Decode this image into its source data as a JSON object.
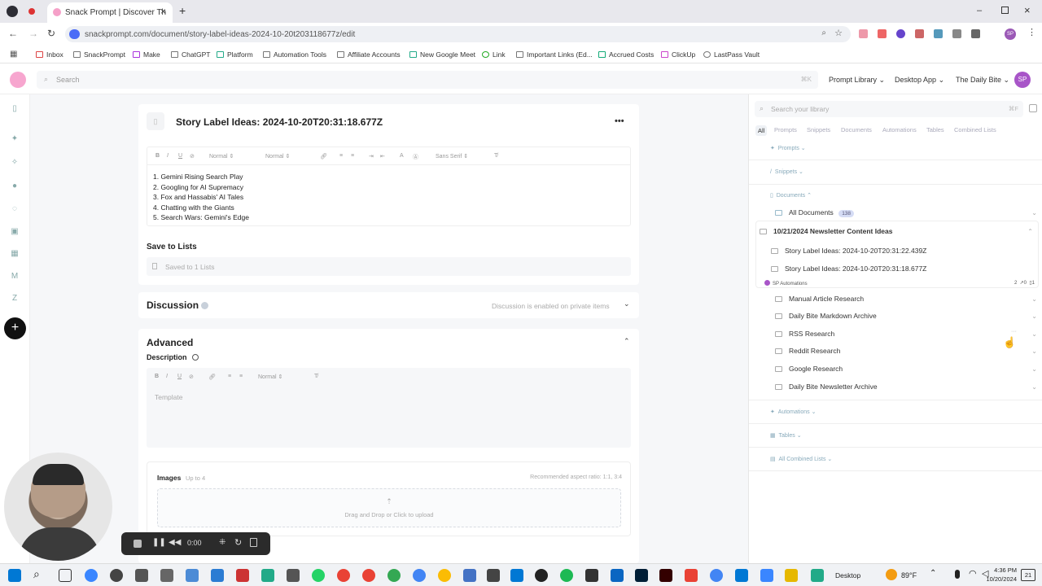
{
  "browser": {
    "tab_title": "Snack Prompt | Discover Th",
    "url": "snackprompt.com/document/story-label-ideas-2024-10-20t203118677z/edit",
    "bookmarks": [
      "Inbox",
      "SnackPrompt",
      "Make",
      "ChatGPT",
      "Platform",
      "Automation Tools",
      "Affiliate Accounts",
      "New Google Meet",
      "Link",
      "Important Links (Ed...",
      "Accrued Costs",
      "ClickUp",
      "LastPass Vault"
    ],
    "profile_initials": "SP"
  },
  "header": {
    "search_placeholder": "Search",
    "search_shortcut": "⌘K",
    "menus": [
      "Prompt Library",
      "Desktop App",
      "The Daily Bite"
    ],
    "avatar": "SP"
  },
  "document": {
    "title": "Story Label Ideas: 2024-10-20T20:31:18.677Z",
    "more_icon": "•••",
    "toolbar": {
      "heading": "Normal",
      "size": "Normal",
      "font": "Sans Serif"
    },
    "lines": [
      "1. Gemini Rising Search Play",
      "2. Googling for AI Supremacy",
      "3. Fox and Hassabis' AI Tales",
      "4. Chatting with the Giants",
      "5. Search Wars: Gemini's Edge"
    ],
    "save_to_lists_label": "Save to Lists",
    "saved_status": "Saved to 1 Lists"
  },
  "discussion": {
    "title": "Discussion",
    "status": "Discussion is enabled on private items"
  },
  "advanced": {
    "title": "Advanced",
    "description_label": "Description",
    "toolbar_size": "Normal",
    "description_placeholder": "Template",
    "images_label": "Images",
    "images_limit": "Up to 4",
    "images_hint": "Recommended aspect ratio: 1:1, 3:4",
    "upload_text": "Drag and Drop or Click to upload"
  },
  "recorder": {
    "time": "0:00"
  },
  "library": {
    "search_placeholder": "Search your library",
    "search_shortcut": "⌘F",
    "filters": [
      "All",
      "Prompts",
      "Snippets",
      "Documents",
      "Automations",
      "Tables",
      "Combined Lists"
    ],
    "sections": {
      "prompts": "Prompts",
      "snippets": "Snippets",
      "documents": "Documents",
      "automations": "Automations",
      "tables": "Tables",
      "combined": "All Combined Lists"
    },
    "all_documents": {
      "label": "All Documents",
      "count": "138"
    },
    "open_folder": {
      "label": "10/21/2024 Newsletter Content Ideas",
      "items": [
        "Story Label Ideas: 2024-10-20T20:31:22.439Z",
        "Story Label Ideas: 2024-10-20T20:31:18.677Z"
      ],
      "owner": "SP Automations",
      "stats": [
        "2",
        "0",
        "1"
      ]
    },
    "folders": [
      "Manual Article Research",
      "Daily Bite Markdown Archive",
      "RSS Research",
      "Reddit Research",
      "Google Research",
      "Daily Bite Newsletter Archive"
    ]
  },
  "taskbar": {
    "desktop_label": "Desktop",
    "weather": "89°F",
    "time": "4:36 PM",
    "date": "10/20/2024",
    "notification_count": "21"
  }
}
